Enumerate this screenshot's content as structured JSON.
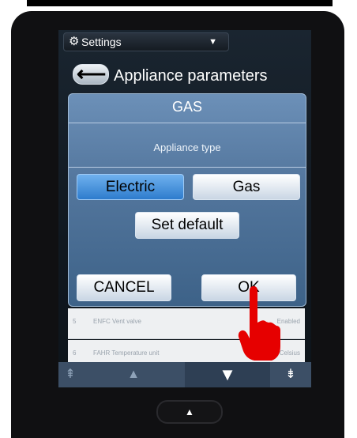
{
  "header": {
    "settings_label": "Settings",
    "title": "Appliance parameters"
  },
  "dialog": {
    "title": "GAS",
    "subtitle": "Appliance type",
    "electric_label": "Electric",
    "gas_label": "Gas",
    "set_default_label": "Set default",
    "cancel_label": "CANCEL",
    "ok_label": "OK",
    "selected_option": "Electric"
  },
  "list": [
    {
      "num": "5",
      "text": "ENFC Vent valve",
      "value": "Enabled"
    },
    {
      "num": "6",
      "text": "FAHR Temperature unit",
      "value": "Celsius"
    }
  ],
  "colors": {
    "dialog_background": "#5f86b0",
    "selected_button": "#3f8ed9",
    "pointer": "#e60000"
  },
  "icons": {
    "gear": "gear-icon",
    "back": "back-arrow-icon",
    "chevron": "chevron-down-icon",
    "hand": "hand-pointer-icon"
  }
}
